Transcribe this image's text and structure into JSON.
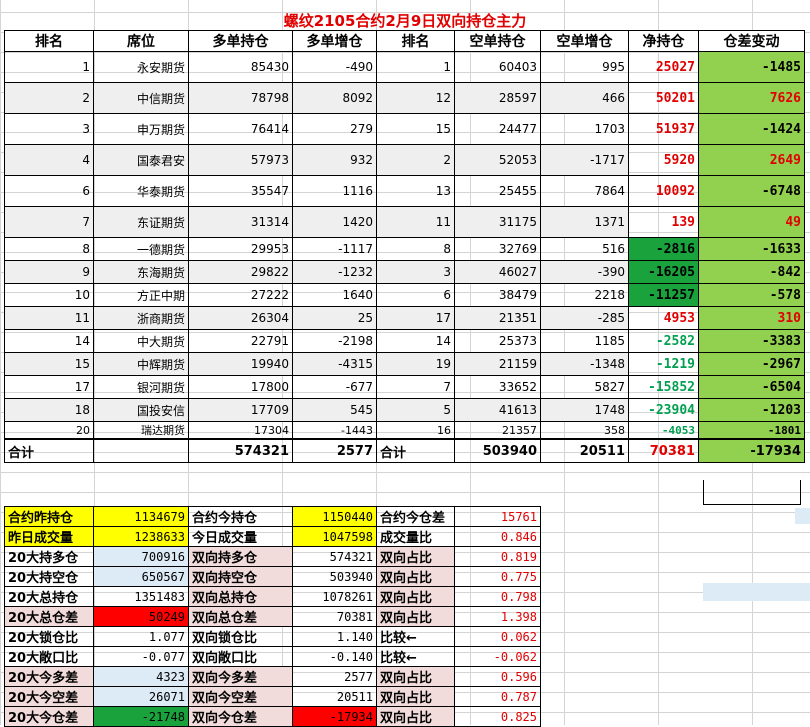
{
  "title": "螺纹2105合约2月9日双向持仓主力",
  "headers": [
    "排名",
    "席位",
    "多单持仓",
    "多单增仓",
    "排名",
    "空单持仓",
    "空单增仓",
    "净持仓",
    "仓差变动"
  ],
  "rows": [
    {
      "rank_long": "1",
      "seat": "永安期货",
      "long": "85430",
      "long_chg": "-490",
      "rank_short": "1",
      "short": "60403",
      "short_chg": "995",
      "net": "25027",
      "diff": "-1485"
    },
    {
      "rank_long": "2",
      "seat": "中信期货",
      "long": "78798",
      "long_chg": "8092",
      "rank_short": "12",
      "short": "28597",
      "short_chg": "466",
      "net": "50201",
      "diff": "7626"
    },
    {
      "rank_long": "3",
      "seat": "申万期货",
      "long": "76414",
      "long_chg": "279",
      "rank_short": "15",
      "short": "24477",
      "short_chg": "1703",
      "net": "51937",
      "diff": "-1424"
    },
    {
      "rank_long": "4",
      "seat": "国泰君安",
      "long": "57973",
      "long_chg": "932",
      "rank_short": "2",
      "short": "52053",
      "short_chg": "-1717",
      "net": "5920",
      "diff": "2649"
    },
    {
      "rank_long": "6",
      "seat": "华泰期货",
      "long": "35547",
      "long_chg": "1116",
      "rank_short": "13",
      "short": "25455",
      "short_chg": "7864",
      "net": "10092",
      "diff": "-6748"
    },
    {
      "rank_long": "7",
      "seat": "东证期货",
      "long": "31314",
      "long_chg": "1420",
      "rank_short": "11",
      "short": "31175",
      "short_chg": "1371",
      "net": "139",
      "diff": "49"
    },
    {
      "rank_long": "8",
      "seat": "一德期货",
      "long": "29953",
      "long_chg": "-1117",
      "rank_short": "8",
      "short": "32769",
      "short_chg": "516",
      "net": "-2816",
      "diff": "-1633"
    },
    {
      "rank_long": "9",
      "seat": "东海期货",
      "long": "29822",
      "long_chg": "-1232",
      "rank_short": "3",
      "short": "46027",
      "short_chg": "-390",
      "net": "-16205",
      "diff": "-842"
    },
    {
      "rank_long": "10",
      "seat": "方正中期",
      "long": "27222",
      "long_chg": "1640",
      "rank_short": "6",
      "short": "38479",
      "short_chg": "2218",
      "net": "-11257",
      "diff": "-578"
    },
    {
      "rank_long": "11",
      "seat": "浙商期货",
      "long": "26304",
      "long_chg": "25",
      "rank_short": "17",
      "short": "21351",
      "short_chg": "-285",
      "net": "4953",
      "diff": "310"
    },
    {
      "rank_long": "14",
      "seat": "中大期货",
      "long": "22791",
      "long_chg": "-2198",
      "rank_short": "14",
      "short": "25373",
      "short_chg": "1185",
      "net": "-2582",
      "diff": "-3383"
    },
    {
      "rank_long": "15",
      "seat": "中辉期货",
      "long": "19940",
      "long_chg": "-4315",
      "rank_short": "19",
      "short": "21159",
      "short_chg": "-1348",
      "net": "-1219",
      "diff": "-2967"
    },
    {
      "rank_long": "17",
      "seat": "银河期货",
      "long": "17800",
      "long_chg": "-677",
      "rank_short": "7",
      "short": "33652",
      "short_chg": "5827",
      "net": "-15852",
      "diff": "-6504"
    },
    {
      "rank_long": "18",
      "seat": "国投安信",
      "long": "17709",
      "long_chg": "545",
      "rank_short": "5",
      "short": "41613",
      "short_chg": "1748",
      "net": "-23904",
      "diff": "-1203"
    },
    {
      "rank_long": "20",
      "seat": "瑞达期货",
      "long": "17304",
      "long_chg": "-1443",
      "rank_short": "16",
      "short": "21357",
      "short_chg": "358",
      "net": "-4053",
      "diff": "-1801"
    }
  ],
  "totals": {
    "label_long": "合计",
    "long": "574321",
    "long_chg": "2577",
    "label_short": "合计",
    "short": "503940",
    "short_chg": "20511",
    "net": "70381",
    "diff": "-17934"
  },
  "stats": [
    {
      "l1": "合约昨持仓",
      "v1": "1134679",
      "l2": "合约今持仓",
      "v2": "1150440",
      "l3": "合约今仓差",
      "v3": "15761"
    },
    {
      "l1": "昨日成交量",
      "v1": "1238633",
      "l2": "今日成交量",
      "v2": "1047598",
      "l3": "成交量比",
      "v3": "0.846"
    },
    {
      "l1": "20大持多仓",
      "v1": "700916",
      "l2": "双向持多仓",
      "v2": "574321",
      "l3": "双向占比",
      "v3": "0.819"
    },
    {
      "l1": "20大持空仓",
      "v1": "650567",
      "l2": "双向持空仓",
      "v2": "503940",
      "l3": "双向占比",
      "v3": "0.775"
    },
    {
      "l1": "20大总持仓",
      "v1": "1351483",
      "l2": "双向总持仓",
      "v2": "1078261",
      "l3": "双向占比",
      "v3": "0.798"
    },
    {
      "l1": "20大总仓差",
      "v1": "50249",
      "l2": "双向总仓差",
      "v2": "70381",
      "l3": "双向占比",
      "v3": "1.398"
    },
    {
      "l1": "20大锁仓比",
      "v1": "1.077",
      "l2": "双向锁仓比",
      "v2": "1.140",
      "l3": "比较←",
      "v3": "0.062"
    },
    {
      "l1": "20大敞口比",
      "v1": "-0.077",
      "l2": "双向敞口比",
      "v2": "-0.140",
      "l3": "比较←",
      "v3": "-0.062"
    },
    {
      "l1": "20大今多差",
      "v1": "4323",
      "l2": "双向今多差",
      "v2": "2577",
      "l3": "双向占比",
      "v3": "0.596"
    },
    {
      "l1": "20大今空差",
      "v1": "26071",
      "l2": "双向今空差",
      "v2": "20511",
      "l3": "双向占比",
      "v3": "0.787"
    },
    {
      "l1": "20大今仓差",
      "v1": "-21748",
      "l2": "双向今仓差",
      "v2": "-17934",
      "l3": "双向占比",
      "v3": "0.825"
    }
  ]
}
